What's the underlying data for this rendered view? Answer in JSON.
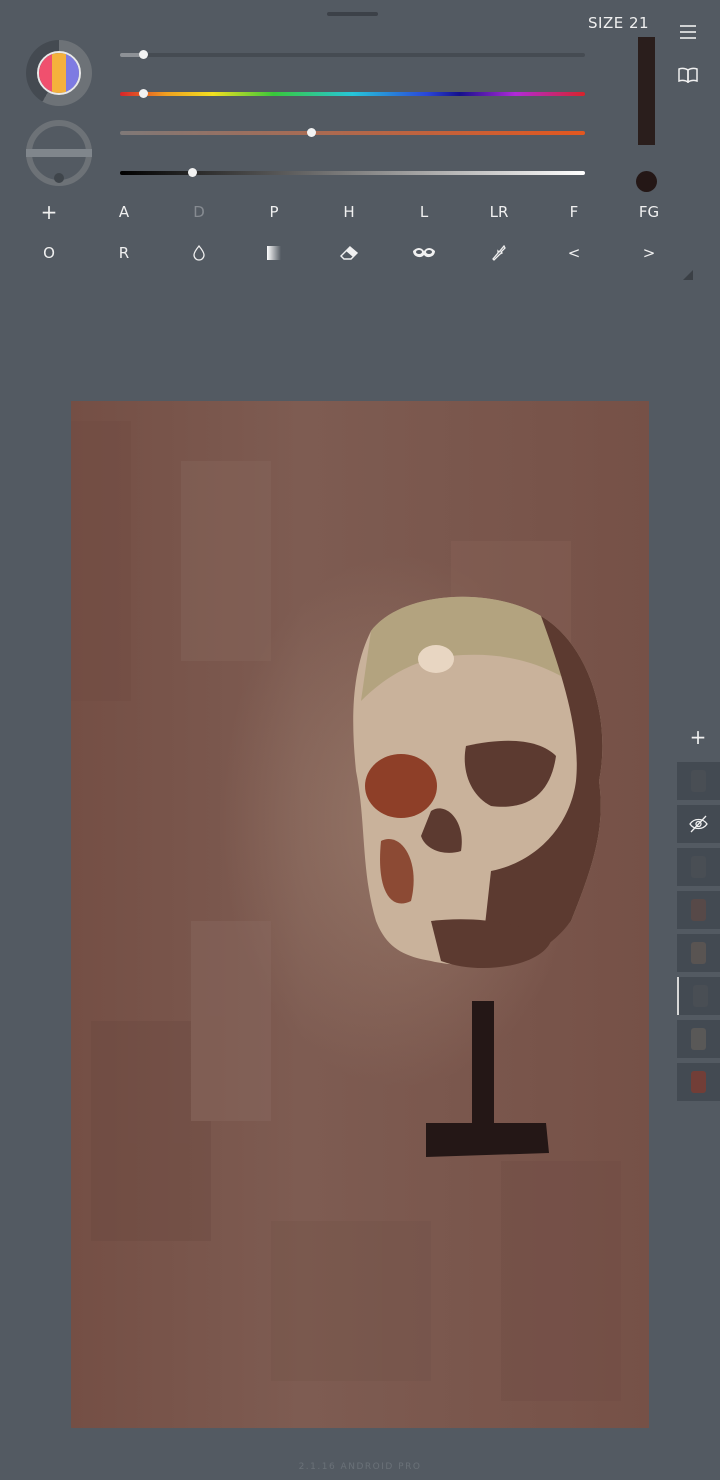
{
  "brush": {
    "size_label": "SIZE 21",
    "size_value": 21,
    "fg_color": "#241716"
  },
  "color_wheel": {
    "segments": [
      "#f0506e",
      "#f5b13c",
      "#7e7be2"
    ]
  },
  "sliders": [
    {
      "name": "brush-size-slider",
      "value": 0.05
    },
    {
      "name": "hue-slider",
      "value": 0.05
    },
    {
      "name": "saturation-slider",
      "value": 0.41
    },
    {
      "name": "lightness-slider",
      "value": 0.155
    }
  ],
  "tools_row1": [
    {
      "label": "+",
      "name": "add-tool",
      "disabled": false
    },
    {
      "label": "A",
      "name": "tool-a",
      "disabled": false
    },
    {
      "label": "D",
      "name": "tool-d",
      "disabled": true
    },
    {
      "label": "P",
      "name": "tool-p",
      "disabled": false
    },
    {
      "label": "H",
      "name": "tool-h",
      "disabled": false
    },
    {
      "label": "L",
      "name": "tool-l",
      "disabled": false
    },
    {
      "label": "LR",
      "name": "tool-lr",
      "disabled": false
    },
    {
      "label": "F",
      "name": "tool-f",
      "disabled": false
    },
    {
      "label": "FG",
      "name": "tool-fg",
      "disabled": false
    }
  ],
  "tools_row2": [
    {
      "label": "O",
      "name": "tool-o",
      "icon": null
    },
    {
      "label": "R",
      "name": "tool-r",
      "icon": null
    },
    {
      "label": "",
      "name": "blend-drop-icon",
      "icon": "drop-icon"
    },
    {
      "label": "",
      "name": "gradient-icon",
      "icon": "gradient-icon"
    },
    {
      "label": "",
      "name": "eraser-icon",
      "icon": "eraser-icon"
    },
    {
      "label": "",
      "name": "mask-icon",
      "icon": "mask-icon"
    },
    {
      "label": "",
      "name": "eyedropper-icon",
      "icon": "eyedropper-icon"
    },
    {
      "label": "<",
      "name": "undo-button",
      "icon": null
    },
    {
      "label": ">",
      "name": "redo-button",
      "icon": null
    }
  ],
  "side_icons": [
    "menu-icon",
    "book-icon"
  ],
  "layers": {
    "add_label": "+",
    "items": [
      {
        "name": "layer-1",
        "hidden": false,
        "selected": false
      },
      {
        "name": "layer-2",
        "hidden": true,
        "selected": false
      },
      {
        "name": "layer-3",
        "hidden": false,
        "selected": false
      },
      {
        "name": "layer-4",
        "hidden": false,
        "selected": false
      },
      {
        "name": "layer-5",
        "hidden": false,
        "selected": false
      },
      {
        "name": "layer-6",
        "hidden": false,
        "selected": true
      },
      {
        "name": "layer-7",
        "hidden": false,
        "selected": false
      },
      {
        "name": "layer-8",
        "hidden": false,
        "selected": false
      }
    ]
  },
  "version": "2.1.16 ANDROID PRO"
}
